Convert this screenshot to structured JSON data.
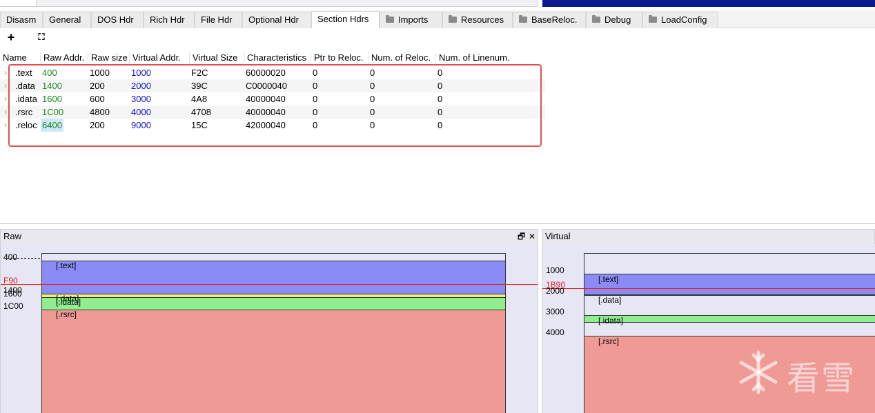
{
  "tabs": [
    {
      "label": "Disasm",
      "active": false,
      "folder": false
    },
    {
      "label": "General",
      "active": false,
      "folder": false
    },
    {
      "label": "DOS Hdr",
      "active": false,
      "folder": false
    },
    {
      "label": "Rich Hdr",
      "active": false,
      "folder": false
    },
    {
      "label": "File Hdr",
      "active": false,
      "folder": false
    },
    {
      "label": "Optional Hdr",
      "active": false,
      "folder": false
    },
    {
      "label": "Section Hdrs",
      "active": true,
      "folder": false
    },
    {
      "label": "Imports",
      "active": false,
      "folder": true
    },
    {
      "label": "Resources",
      "active": false,
      "folder": true
    },
    {
      "label": "BaseReloc.",
      "active": false,
      "folder": true
    },
    {
      "label": "Debug",
      "active": false,
      "folder": true
    },
    {
      "label": "LoadConfig",
      "active": false,
      "folder": true
    }
  ],
  "toolbar": {
    "add_icon": "plus-icon",
    "fit_icon": "fit-screen-icon",
    "add_glyph": "+",
    "fit_glyph": "⛶"
  },
  "table": {
    "columns": [
      "Name",
      "Raw Addr.",
      "Raw size",
      "Virtual Addr.",
      "Virtual Size",
      "Characteristics",
      "Ptr to Reloc.",
      "Num. of Reloc.",
      "Num. of Linenum."
    ],
    "rows": [
      {
        "name": ".text",
        "raw_addr": "400",
        "raw_size": "1000",
        "virt_addr": "1000",
        "virt_size": "F2C",
        "characteristics": "60000020",
        "ptr_reloc": "0",
        "num_reloc": "0",
        "num_linenum": "0"
      },
      {
        "name": ".data",
        "raw_addr": "1400",
        "raw_size": "200",
        "virt_addr": "2000",
        "virt_size": "39C",
        "characteristics": "C0000040",
        "ptr_reloc": "0",
        "num_reloc": "0",
        "num_linenum": "0"
      },
      {
        "name": ".idata",
        "raw_addr": "1600",
        "raw_size": "600",
        "virt_addr": "3000",
        "virt_size": "4A8",
        "characteristics": "40000040",
        "ptr_reloc": "0",
        "num_reloc": "0",
        "num_linenum": "0"
      },
      {
        "name": ".rsrc",
        "raw_addr": "1C00",
        "raw_size": "4800",
        "virt_addr": "4000",
        "virt_size": "4708",
        "characteristics": "40000040",
        "ptr_reloc": "0",
        "num_reloc": "0",
        "num_linenum": "0"
      },
      {
        "name": ".reloc",
        "raw_addr": "6400",
        "raw_size": "200",
        "virt_addr": "9000",
        "virt_size": "15C",
        "characteristics": "42000040",
        "ptr_reloc": "0",
        "num_reloc": "0",
        "num_linenum": "0"
      }
    ]
  },
  "raw_panel": {
    "title": "Raw",
    "restore_glyph": "🗗",
    "close_glyph": "✕",
    "axis": [
      "400",
      "F90",
      "1400",
      "1600",
      "1C00"
    ],
    "sections": [
      "[.text]",
      "[.data]",
      "[.idata]",
      "[.rsrc]"
    ]
  },
  "virtual_panel": {
    "title": "Virtual",
    "axis": [
      "1000",
      "1B90",
      "2000",
      "3000",
      "4000"
    ],
    "sections": [
      "[.text]",
      "[.data]",
      "[.idata]",
      "[.rsrc]"
    ]
  },
  "watermark": {
    "text": "看雪"
  },
  "colors": {
    "text_section": "#8b8bf5",
    "data_section": "#eef07a",
    "idata_section": "#90ee90",
    "rsrc_section": "#f09a96",
    "highlight_box": "#e05050",
    "raw_addr_color": "#1a8a1a",
    "virt_addr_color": "#1010c8"
  }
}
